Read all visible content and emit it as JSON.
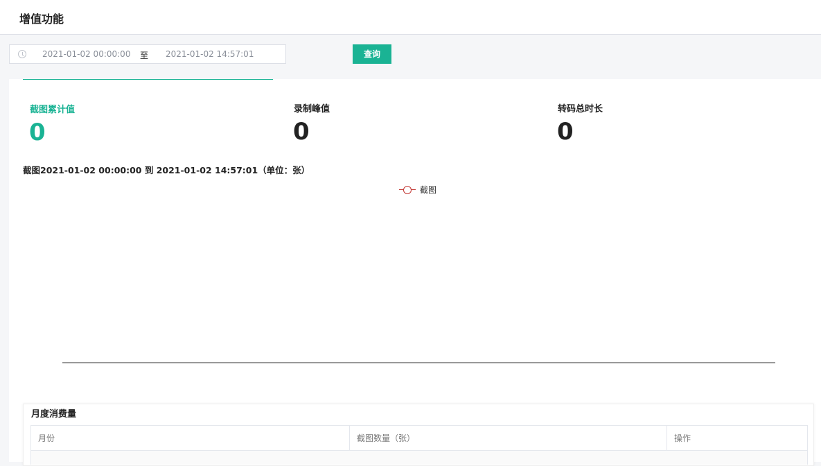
{
  "header": {
    "title": "增值功能"
  },
  "filter": {
    "start": "2021-01-02 00:00:00",
    "separator": "至",
    "end": "2021-01-02 14:57:01",
    "query_label": "查询"
  },
  "stats": [
    {
      "label": "截图累计值",
      "value": "0",
      "active": true
    },
    {
      "label": "录制峰值",
      "value": "0",
      "active": false
    },
    {
      "label": "转码总时长",
      "value": "0",
      "active": false
    }
  ],
  "chart": {
    "title": "截图2021-01-02 00:00:00 到 2021-01-02 14:57:01（单位：张）",
    "legend": "截图",
    "series_color": "#c23531",
    "accent": "#1ab394"
  },
  "chart_data": {
    "type": "line",
    "title": "截图2021-01-02 00:00:00 到 2021-01-02 14:57:01（单位：张）",
    "series": [
      {
        "name": "截图",
        "values": []
      }
    ],
    "x": [],
    "xlabel": "",
    "ylabel": "",
    "legend": "top-center",
    "grid": false
  },
  "table": {
    "title": "月度消费量",
    "columns": [
      "月份",
      "截图数量（张）",
      "操作"
    ],
    "rows": []
  }
}
